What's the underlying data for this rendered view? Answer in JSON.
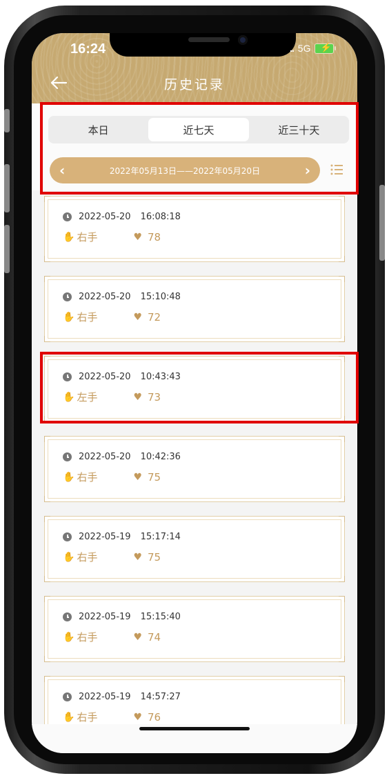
{
  "status_bar": {
    "time": "16:24",
    "signal": "..",
    "network": "5G"
  },
  "header": {
    "title": "历史记录",
    "back_icon": "arrow-left-icon"
  },
  "tabs": [
    {
      "label": "本日",
      "active": false
    },
    {
      "label": "近七天",
      "active": true
    },
    {
      "label": "近三十天",
      "active": false
    }
  ],
  "date_range": {
    "text": "2022年05月13日——2022年05月20日",
    "prev_icon": "chevron-left-icon",
    "next_icon": "chevron-right-icon",
    "list_icon": "list-icon"
  },
  "records": [
    {
      "date": "2022-05-20",
      "time": "16:08:18",
      "hand": "右手",
      "value": "78"
    },
    {
      "date": "2022-05-20",
      "time": "15:10:48",
      "hand": "右手",
      "value": "72"
    },
    {
      "date": "2022-05-20",
      "time": "10:43:43",
      "hand": "左手",
      "value": "73"
    },
    {
      "date": "2022-05-20",
      "time": "10:42:36",
      "hand": "右手",
      "value": "75"
    },
    {
      "date": "2022-05-19",
      "time": "15:17:14",
      "hand": "右手",
      "value": "75"
    },
    {
      "date": "2022-05-19",
      "time": "15:15:40",
      "hand": "右手",
      "value": "74"
    },
    {
      "date": "2022-05-19",
      "time": "14:57:27",
      "hand": "右手",
      "value": "76"
    }
  ],
  "colors": {
    "accent": "#c49a5c",
    "header_bg": "#c6a971",
    "highlight": "#e00000"
  }
}
